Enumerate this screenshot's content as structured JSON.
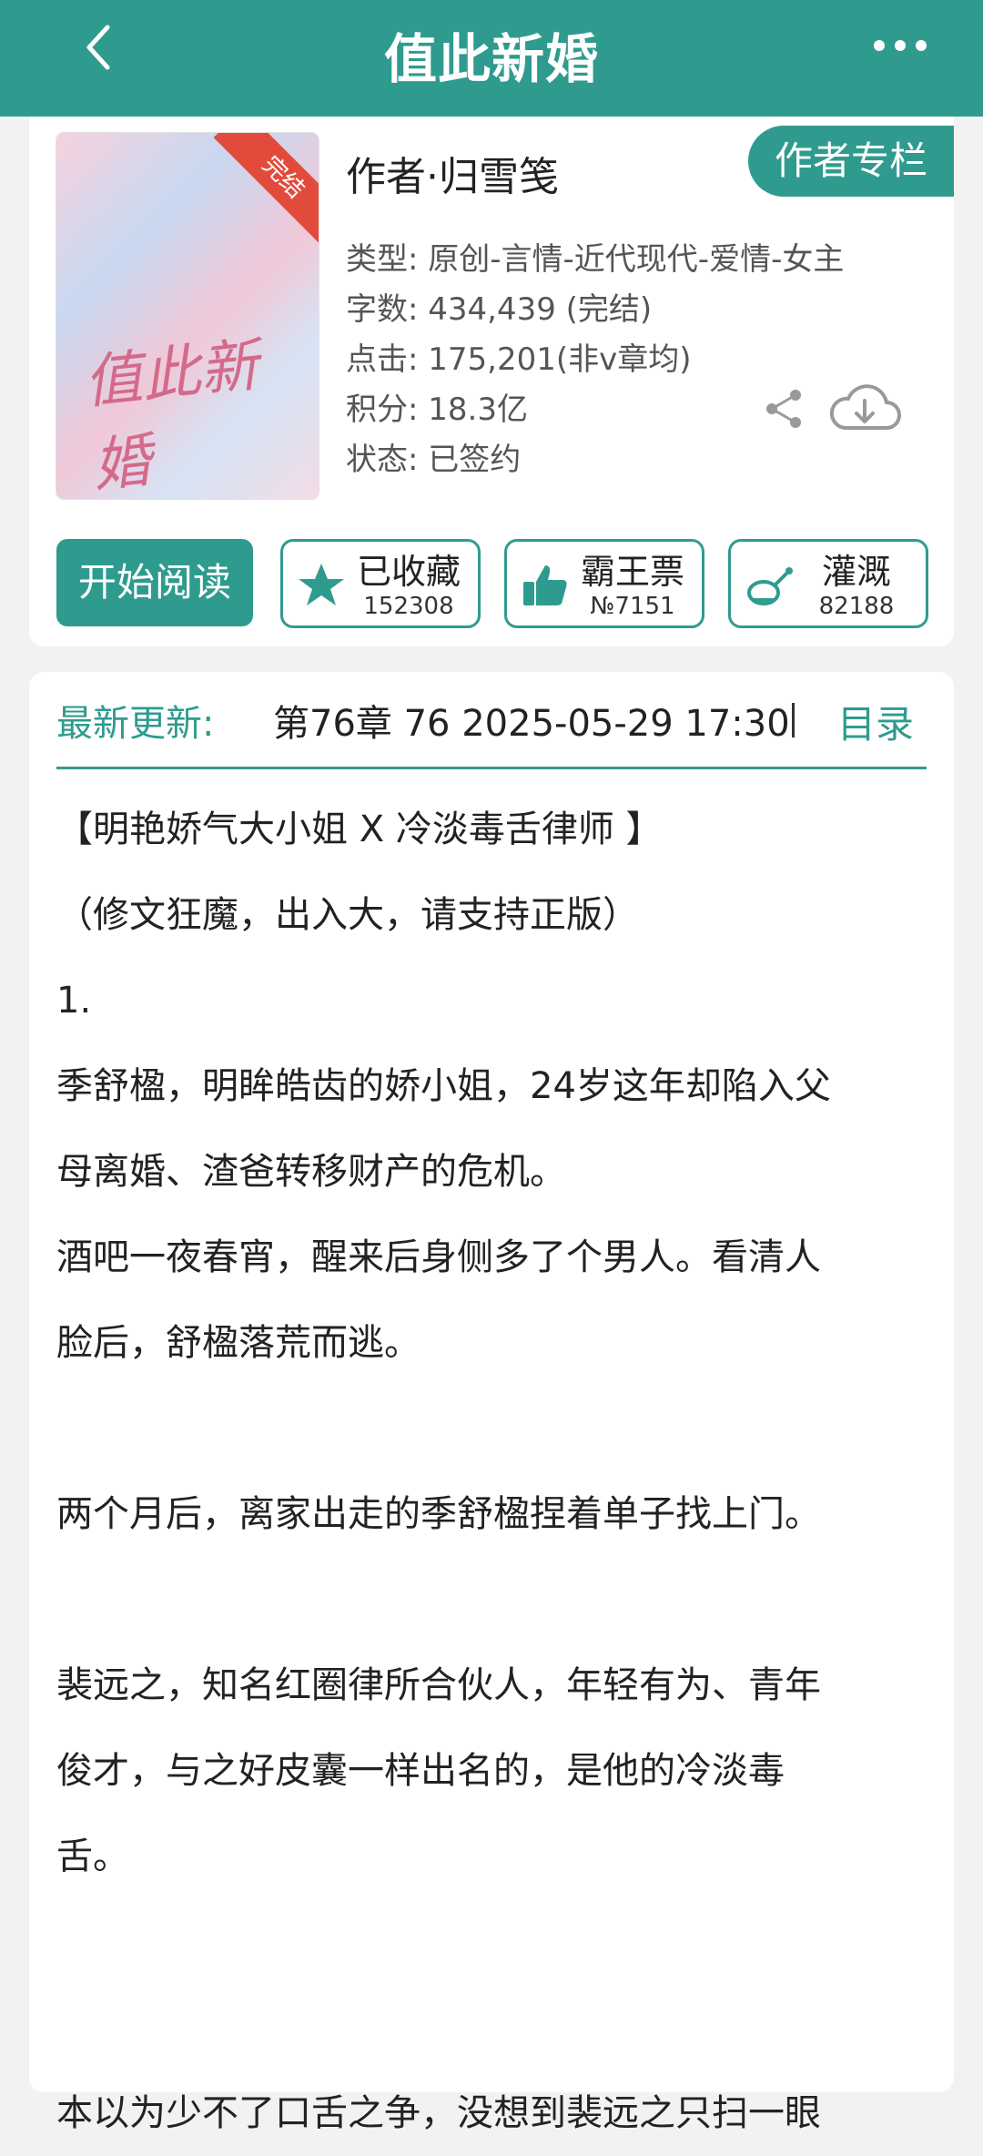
{
  "header": {
    "title": "值此新婚",
    "back_icon": "chevron-left-icon",
    "more_icon": "more-dots-icon"
  },
  "book": {
    "cover_title": "值此新婚",
    "badge": "完结",
    "author": "作者·归雪笺",
    "author_column_label": "作者专栏",
    "meta": [
      "类型: 原创-言情-近代现代-爱情-女主",
      "字数: 434,439 (完结)",
      "点击: 175,201(非v章均)",
      "积分: 18.3亿",
      "状态: 已签约"
    ]
  },
  "actions": {
    "read_label": "开始阅读",
    "buttons": [
      {
        "label": "已收藏",
        "count": "152308",
        "icon": "star-icon"
      },
      {
        "label": "霸王票",
        "count": "№7151",
        "icon": "thumbs-up-icon"
      },
      {
        "label": "灌溉",
        "count": "82188",
        "icon": "watering-can-icon"
      }
    ]
  },
  "update": {
    "label": "最新更新:",
    "value": "第76章  76  2025-05-29 17:30",
    "toc_label": "目录"
  },
  "intro": [
    "【明艳娇气大小姐 X 冷淡毒舌律师 】",
    "（修文狂魔，出入大，请支持正版）",
    "1.",
    "季舒楹，明眸皓齿的娇小姐，24岁这年却陷入父",
    "母离婚、渣爸转移财产的危机。",
    "酒吧一夜春宵，醒来后身侧多了个男人。看清人",
    "脸后，舒楹落荒而逃。",
    "",
    "两个月后，离家出走的季舒楹捏着单子找上门。",
    "",
    "裴远之，知名红圈律所合伙人，年轻有为、青年",
    "俊才，与之好皮囊一样出名的，是他的冷淡毒",
    "舌。",
    "",
    "",
    "本以为少不了口舌之争，没想到裴远之只扫一眼"
  ],
  "colors": {
    "accent": "#2f9b8f",
    "badge": "#e24b3b"
  }
}
